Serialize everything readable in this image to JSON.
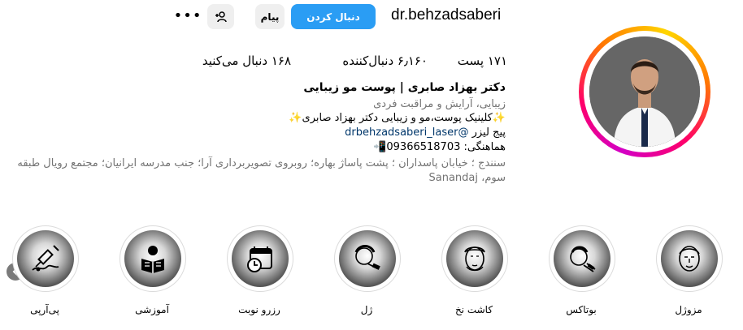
{
  "header": {
    "username": "dr.behzadsaberi",
    "follow_label": "دنبال کردن",
    "message_label": "پیام",
    "more_label": "•••"
  },
  "stats": {
    "posts": "۱۷۱ پست",
    "followers": "۶٫۱۶۰ دنبال‌کننده",
    "following": "۱۶۸ دنبال می‌کنید"
  },
  "bio": {
    "name": "دکتر بهزاد صابری | پوست مو زیبایی",
    "category": "زیبایی، آرایش و مراقبت فردی",
    "line1": "✨کلینیک پوست،مو و زیبایی دکتر بهزاد صابری✨",
    "line2_prefix": "پیج لیزر ",
    "line2_link": "@drbehzadsaberi_laser",
    "line3": "هماهنگی: 09366518703📲",
    "address": "سنندج ؛ خیابان پاسداران ؛ پشت پاساژ بهاره؛ روبروی تصویربرداری آرا؛ جنب مدرسه ایرانیان؛ مجتمع رویال طبقه سوم، Sanandaj"
  },
  "highlights": [
    {
      "label": "مزوژل",
      "icon": "face-icon"
    },
    {
      "label": "بوتاکس",
      "icon": "syringe-face-icon"
    },
    {
      "label": "کاشت نخ",
      "icon": "face-thread-icon"
    },
    {
      "label": "ژل",
      "icon": "gel-injection-icon"
    },
    {
      "label": "رزرو نوبت",
      "icon": "calendar-clock-icon"
    },
    {
      "label": "آموزشی",
      "icon": "reader-book-icon"
    },
    {
      "label": "پی‌آر‌پی",
      "icon": "hair-syringe-icon"
    }
  ],
  "colors": {
    "follow": "#2a9df4",
    "secondary_button": "#efefef",
    "muted_text": "#737373",
    "link": "#00376b"
  }
}
